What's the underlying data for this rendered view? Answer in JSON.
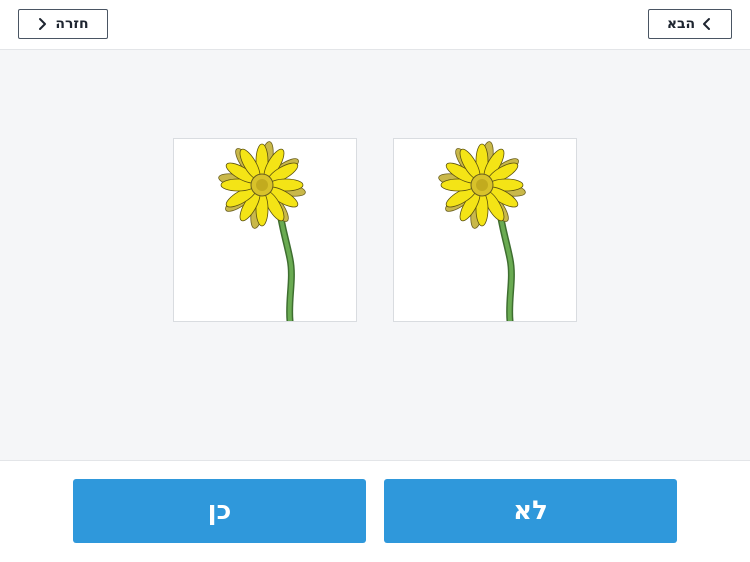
{
  "header": {
    "back_label": "חזרה",
    "next_label": "הבא"
  },
  "stage": {
    "left_image_icon": "yellow-daisy-icon",
    "right_image_icon": "yellow-daisy-icon"
  },
  "answers": {
    "yes_label": "כן",
    "no_label": "לא"
  },
  "colors": {
    "accent": "#2f98db",
    "stage_bg": "#f5f6f8",
    "petal": "#f4e416",
    "stem": "#5a9a45"
  }
}
